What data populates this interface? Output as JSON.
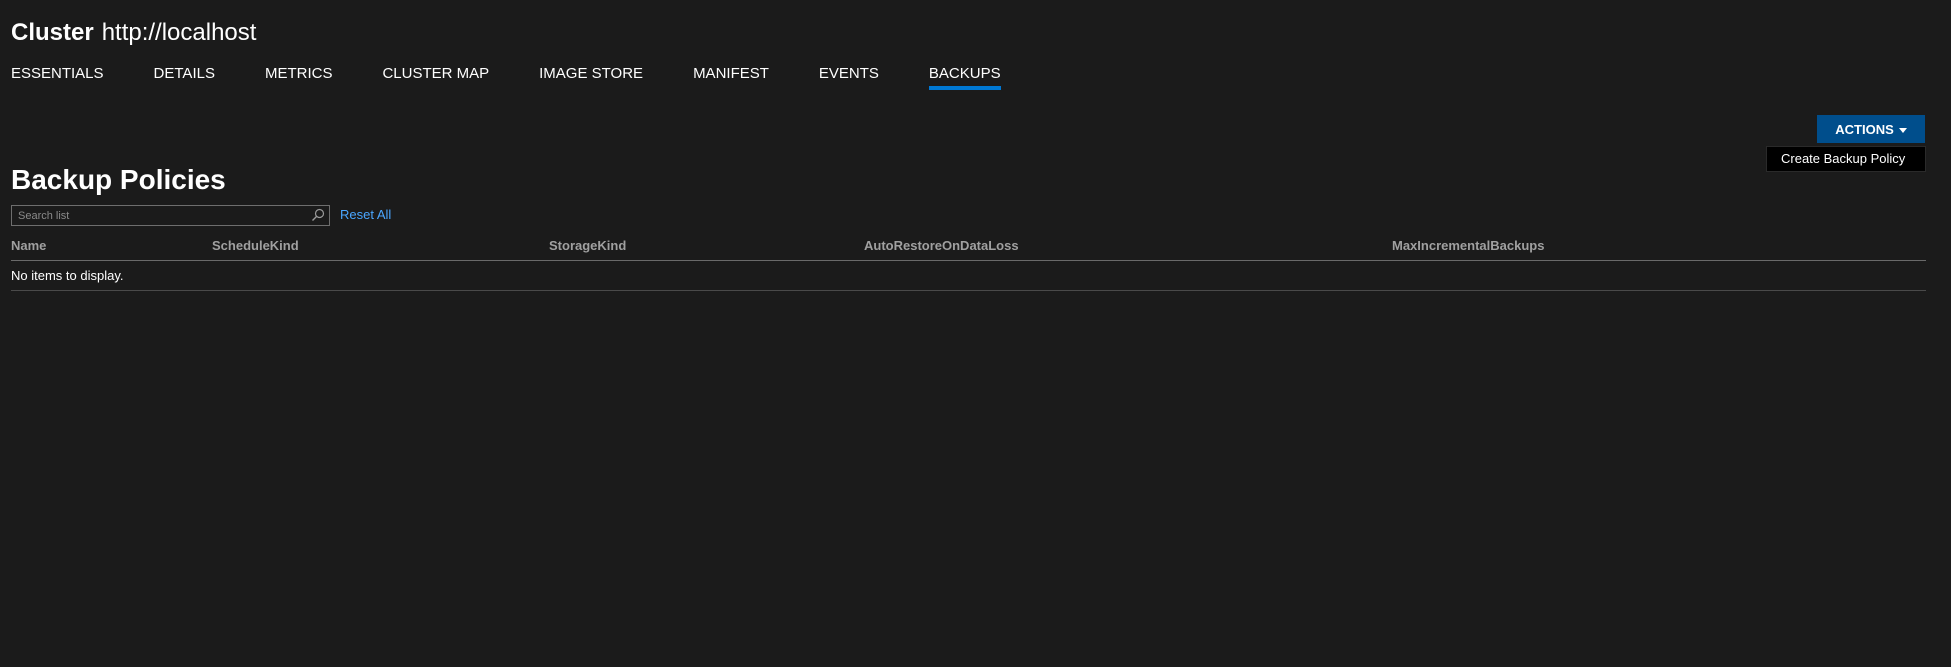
{
  "header": {
    "type_label": "Cluster",
    "name": "http://localhost"
  },
  "tabs": [
    {
      "label": "ESSENTIALS",
      "active": false
    },
    {
      "label": "DETAILS",
      "active": false
    },
    {
      "label": "METRICS",
      "active": false
    },
    {
      "label": "CLUSTER MAP",
      "active": false
    },
    {
      "label": "IMAGE STORE",
      "active": false
    },
    {
      "label": "MANIFEST",
      "active": false
    },
    {
      "label": "EVENTS",
      "active": false
    },
    {
      "label": "BACKUPS",
      "active": true
    }
  ],
  "actions": {
    "button_label": "ACTIONS",
    "menu_items": [
      "Create Backup Policy"
    ]
  },
  "page": {
    "title": "Backup Policies"
  },
  "search": {
    "placeholder": "Search list",
    "value": ""
  },
  "reset_all_label": "Reset All",
  "table": {
    "columns": [
      "Name",
      "ScheduleKind",
      "StorageKind",
      "AutoRestoreOnDataLoss",
      "MaxIncrementalBackups"
    ],
    "empty_message": "No items to display.",
    "rows": []
  },
  "colors": {
    "background": "#1b1b1b",
    "accent": "#0078d4",
    "button": "#004e8c",
    "link": "#4aa6ff"
  }
}
